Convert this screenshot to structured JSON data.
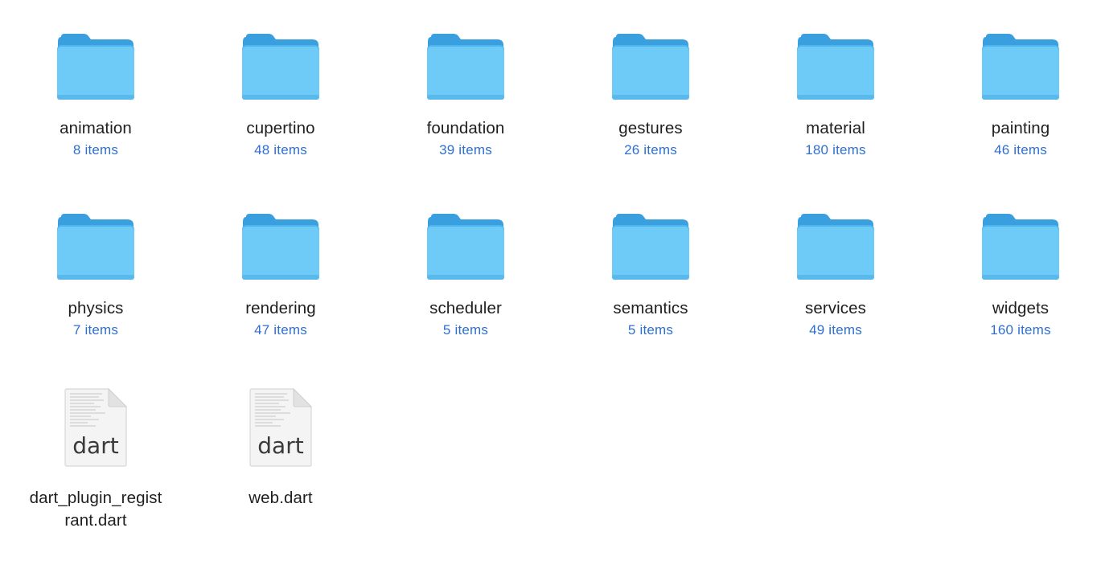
{
  "finder": {
    "folders": [
      {
        "name": "animation",
        "count": "8 items"
      },
      {
        "name": "cupertino",
        "count": "48 items"
      },
      {
        "name": "foundation",
        "count": "39 items"
      },
      {
        "name": "gestures",
        "count": "26 items"
      },
      {
        "name": "material",
        "count": "180 items"
      },
      {
        "name": "painting",
        "count": "46 items"
      },
      {
        "name": "physics",
        "count": "7 items"
      },
      {
        "name": "rendering",
        "count": "47 items"
      },
      {
        "name": "scheduler",
        "count": "5 items"
      },
      {
        "name": "semantics",
        "count": "5 items"
      },
      {
        "name": "services",
        "count": "49 items"
      },
      {
        "name": "widgets",
        "count": "160 items"
      }
    ],
    "files": [
      {
        "name": "dart_plugin_regist\nrant.dart",
        "ext_label": "dart",
        "icon": "dart-file-icon"
      },
      {
        "name": "web.dart",
        "ext_label": "dart",
        "icon": "dart-file-icon"
      }
    ],
    "colors": {
      "folder_front": "#6ECBF8",
      "folder_back": "#3A9FDF",
      "count_text": "#2F6FD0"
    }
  }
}
